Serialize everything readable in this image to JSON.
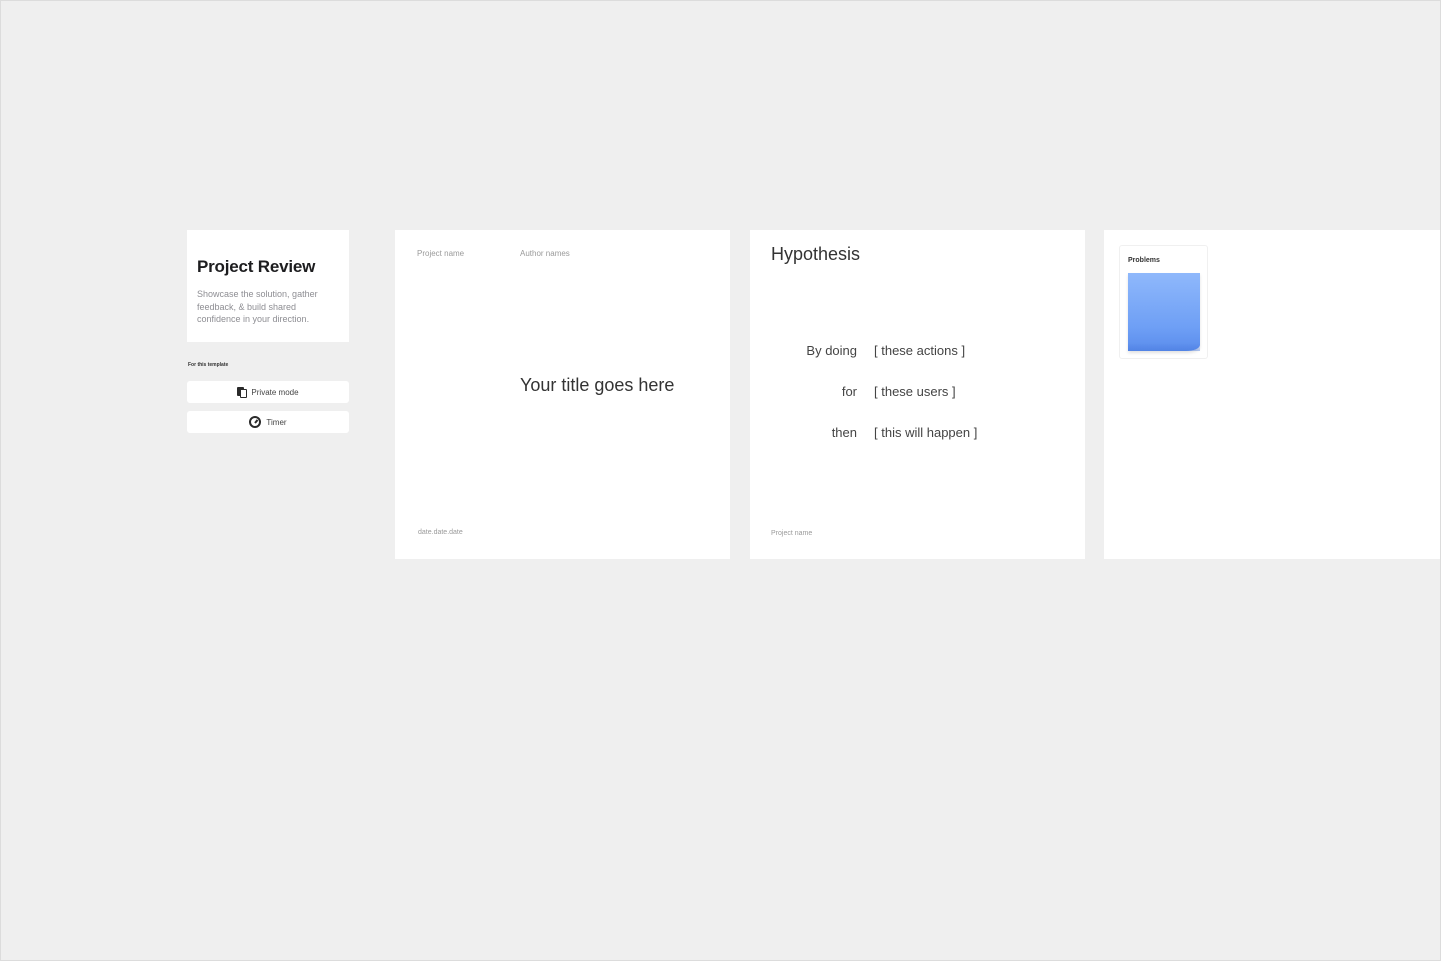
{
  "intro": {
    "title": "Project Review",
    "description": "Showcase the solution, gather feedback, & build shared confidence in your direction.",
    "for_template": "For this template",
    "buttons": {
      "private_mode": "Private mode",
      "timer": "Timer"
    }
  },
  "slide_title": {
    "project_name": "Project name",
    "author_names": "Author names",
    "title": "Your title goes here",
    "date": "date.date.date"
  },
  "slide_hypothesis": {
    "title": "Hypothesis",
    "rows": [
      {
        "key": "By doing",
        "value": "[ these actions ]"
      },
      {
        "key": "for",
        "value": "[ these users ]"
      },
      {
        "key": "then",
        "value": "[ this will happen ]"
      }
    ],
    "footer": "Project name"
  },
  "slide_problems": {
    "label": "Problems",
    "sticky_color": "#7aa8f7"
  }
}
